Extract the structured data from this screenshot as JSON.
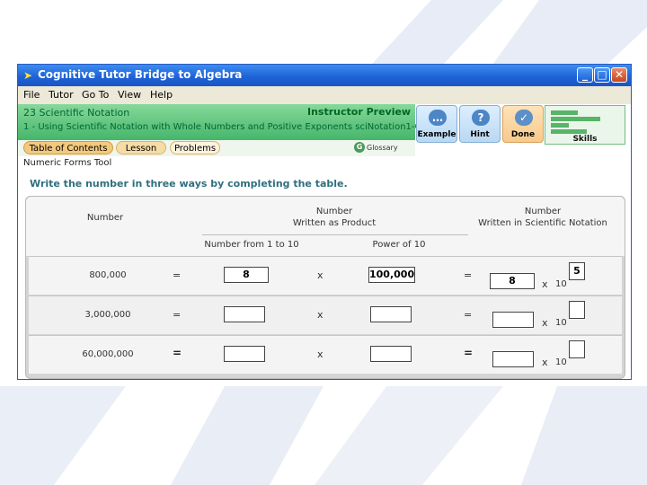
{
  "window": {
    "title": "Cognitive Tutor Bridge to Algebra",
    "controls": {
      "minimize": "_",
      "maximize": "□",
      "close": "✕"
    }
  },
  "menu": [
    "File",
    "Tutor",
    "Go To",
    "View",
    "Help"
  ],
  "lesson": {
    "unit": "23   Scientific Notation",
    "section": "1 - Using Scientific Notation with Whole Numbers and Positive Exponents  sciNotation1-008",
    "mode": "Instructor Preview"
  },
  "tabs": [
    "Table of Contents",
    "Lesson",
    "Problems"
  ],
  "glossary_label": "Glossary",
  "tools": [
    {
      "label": "Example",
      "icon": "speech-bubble-icon"
    },
    {
      "label": "Hint",
      "icon": "question-icon"
    },
    {
      "label": "Done",
      "icon": "checkmark-icon"
    }
  ],
  "skills_label": "Skills",
  "tool_name": "Numeric Forms Tool",
  "instruction": "Write the number in three ways by completing the table.",
  "table": {
    "headers": {
      "number": "Number",
      "product_line1": "Number",
      "product_line2": "Written as Product",
      "sci_line1": "Number",
      "sci_line2": "Written in Scientific Notation",
      "factor": "Number from 1 to 10",
      "power": "Power of 10"
    },
    "rows": [
      {
        "number": "800,000",
        "eq1": "=",
        "factor": "8",
        "times": "x",
        "power": "100,000",
        "eq2": "=",
        "sci_coef": "8",
        "times2": "x",
        "ten": "10",
        "exponent": "5"
      },
      {
        "number": "3,000,000",
        "eq1": "=",
        "factor": "",
        "times": "x",
        "power": "",
        "eq2": "=",
        "sci_coef": "",
        "times2": "x",
        "ten": "10",
        "exponent": ""
      },
      {
        "number": "60,000,000",
        "eq1": "=",
        "factor": "",
        "times": "x",
        "power": "",
        "eq2": "=",
        "sci_coef": "",
        "times2": "x",
        "ten": "10",
        "exponent": ""
      }
    ]
  },
  "colors": {
    "titlebar": "#1f63d8",
    "lesson_bar": "#45b66a",
    "instruction": "#2f6f7f",
    "done_button": "#f7c98c"
  }
}
